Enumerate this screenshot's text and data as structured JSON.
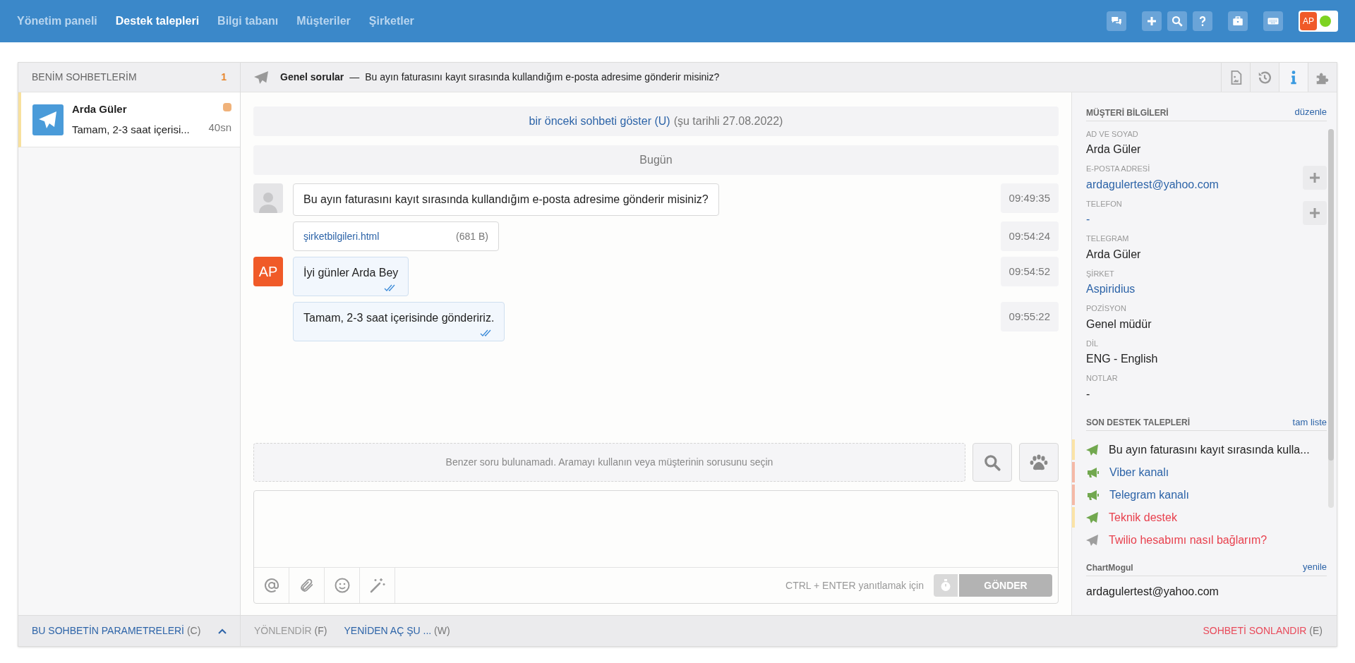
{
  "nav": {
    "items": [
      {
        "label": "Yönetim paneli",
        "selected": false
      },
      {
        "label": "Destek talepleri",
        "selected": true
      },
      {
        "label": "Bilgi tabanı",
        "selected": false
      },
      {
        "label": "Müşteriler",
        "selected": false
      },
      {
        "label": "Şirketler",
        "selected": false
      }
    ],
    "user": {
      "initials": "AP",
      "online": true
    }
  },
  "chat_list": {
    "title": "BENİM SOHBETLERİM",
    "count": "1",
    "items": [
      {
        "name": "Arda Güler",
        "preview": "Tamam, 2-3 saat içerisi...",
        "time": "40sn",
        "selected": true,
        "color": "#f0b27a"
      }
    ]
  },
  "chat": {
    "category": "Genel sorular",
    "separator": "—",
    "subject": "Bu ayın faturasını kayıt sırasında kullandığım e-posta adresime gönderir misiniz?",
    "tabs": [
      {
        "kind": "file",
        "selected": false
      },
      {
        "kind": "history",
        "selected": false
      },
      {
        "kind": "info",
        "selected": true
      },
      {
        "kind": "plugin",
        "selected": false
      }
    ],
    "previous": {
      "link": "bir önceki sohbeti göster (U)",
      "note": "(şu tarihli 27.08.2022)"
    },
    "day": "Bugün",
    "messages": [
      {
        "kind": "text",
        "outgoing": false,
        "text": "Bu ayın faturasını kayıt sırasında kullandığım e-posta adresime gönderir misiniz?",
        "time": "09:49:35",
        "read": false
      },
      {
        "kind": "file",
        "outgoing": false,
        "file": "şirketbilgileri.html",
        "size": "(681 B)",
        "time": "09:54:24"
      },
      {
        "kind": "text",
        "outgoing": true,
        "avatar": "AP",
        "text": "İyi günler Arda Bey",
        "time": "09:54:52",
        "read": true
      },
      {
        "kind": "text",
        "outgoing": true,
        "text": "Tamam, 2-3 saat içerisinde göndeririz.",
        "time": "09:55:22",
        "read": true
      }
    ],
    "suggestions": "Benzer soru bulunamadı. Aramayı kullanın veya müşterinin sorusunu seçin",
    "hint": "CTRL + ENTER yanıtlamak için",
    "send": "GÖNDER"
  },
  "customer": {
    "title": "MÜŞTERİ BİLGİLERİ",
    "edit": "düzenle",
    "fields": [
      {
        "label": "AD VE SOYAD",
        "value": "Arda Güler",
        "link": false,
        "addable": false
      },
      {
        "label": "E-POSTA ADRESİ",
        "value": "ardagulertest@yahoo.com",
        "link": true,
        "addable": true
      },
      {
        "label": "TELEFON",
        "value": "-",
        "link": true,
        "addable": true
      },
      {
        "label": "TELEGRAM",
        "value": "Arda Güler",
        "link": false,
        "addable": false
      },
      {
        "label": "ŞİRKET",
        "value": "Aspiridius",
        "link": true,
        "addable": false
      },
      {
        "label": "POZİSYON",
        "value": "Genel müdür",
        "link": false,
        "addable": false
      },
      {
        "label": "DİL",
        "value": "ENG - English",
        "link": false,
        "addable": false
      },
      {
        "label": "NOTLAR",
        "value": "-",
        "link": false,
        "addable": false
      }
    ]
  },
  "recent": {
    "title": "SON DESTEK TALEPLERİ",
    "more": "tam liste",
    "items": [
      {
        "kind": "telegram",
        "color": "#fbe3a6",
        "icon": {
          "color": "#72a84f"
        },
        "title": {
          "text": "Bu ayın faturasını kayıt sırasında kulla...",
          "color": "#222222"
        }
      },
      {
        "kind": "channel",
        "color": "#f5b9a6",
        "icon": {
          "color": "#72a84f"
        },
        "title": {
          "text": "Viber kanalı",
          "color": "#2d64a8"
        }
      },
      {
        "kind": "channel",
        "color": "#f5b9a6",
        "icon": {
          "color": "#72a84f"
        },
        "title": {
          "text": "Telegram kanalı",
          "color": "#2d64a8"
        }
      },
      {
        "kind": "telegram",
        "color": "#fbe3a6",
        "icon": {
          "color": "#72a84f"
        },
        "title": {
          "text": "Teknik destek",
          "color": "#e8414e"
        }
      },
      {
        "kind": "telegram",
        "color": "#f5f5f7",
        "icon": {
          "color": "#9e9e9e"
        },
        "title": {
          "text": "Twilio hesabımı nasıl bağlarım?",
          "color": "#e8414e"
        }
      }
    ]
  },
  "chartmogul": {
    "title": "ChartMogul",
    "refresh": "yenile",
    "value": "ardagulertest@yahoo.com"
  },
  "footer": {
    "params": {
      "label": "BU SOHBETİN PARAMETRELERİ",
      "key": "(C)"
    },
    "actions": [
      {
        "label": "YÖNLENDİR",
        "key": "(F)",
        "disabled": true
      },
      {
        "label": "YENİDEN AÇ ŞU ...",
        "key": "(W)",
        "disabled": false
      }
    ],
    "end": {
      "label": "SOHBETİ SONLANDIR",
      "key": "(E)"
    }
  }
}
